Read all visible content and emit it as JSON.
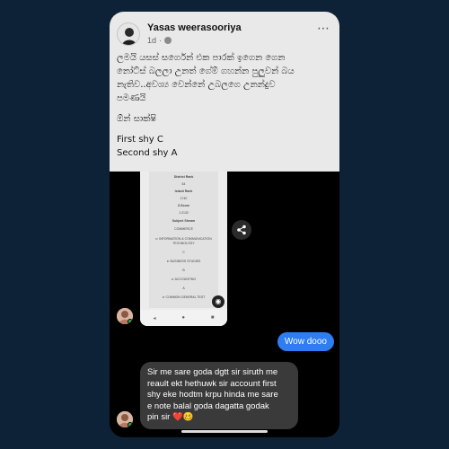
{
  "post": {
    "author": "Yasas weerasooriya",
    "time": "1d",
    "separator": "·",
    "more_icon": "⋯",
    "body_paragraph": [
      "ලමයි යසස් සර්ගෙන් එක පාරක් ඉගෙන ගෙන",
      "නෝට්ස් බලලා උනත් ගේම් ගහන්න පුලුවන් බය",
      "නැතිව..අවශ්‍ය වෙන්නේ උබලගෙ උනන්දුව",
      "පමණයි"
    ],
    "proof_label": "ඕන් සාක්ෂි",
    "results": [
      "First shy C",
      "Second shy  A"
    ]
  },
  "screenshot": {
    "lines": [
      "District Rank",
      "64",
      "Island Rank",
      "1740",
      "Z-Score",
      "1.2132",
      "Subject Stream",
      "COMMERCE",
      "",
      "⊳ INFORMATION & COMMUNICATION",
      "TECHNOLOGY",
      "C",
      "⊳ BUSINESS STUDIES",
      "B",
      "⊳ ACCOUNTING",
      "A",
      "⊳ COMMON GENERAL TEST"
    ],
    "nav_icons": [
      "◂",
      "●",
      "■"
    ],
    "fab_icon": "◉"
  },
  "share_icon": "share-icon",
  "messages": {
    "outgoing": "Wow dooo",
    "incoming_lines": [
      "Sir me sare goda dgtt sir siruth me",
      "reault ekt hethuwk sir account first",
      "shy eke hodtm krpu hinda me sare",
      "e note balal goda dagatta godak",
      "pin sir ❤️🥴"
    ]
  },
  "colors": {
    "background": "#0d2236",
    "post_bg": "#e9e9ea",
    "bubble_out": "#2e7df2",
    "bubble_in": "#3a3a3a",
    "online": "#31a24c"
  }
}
